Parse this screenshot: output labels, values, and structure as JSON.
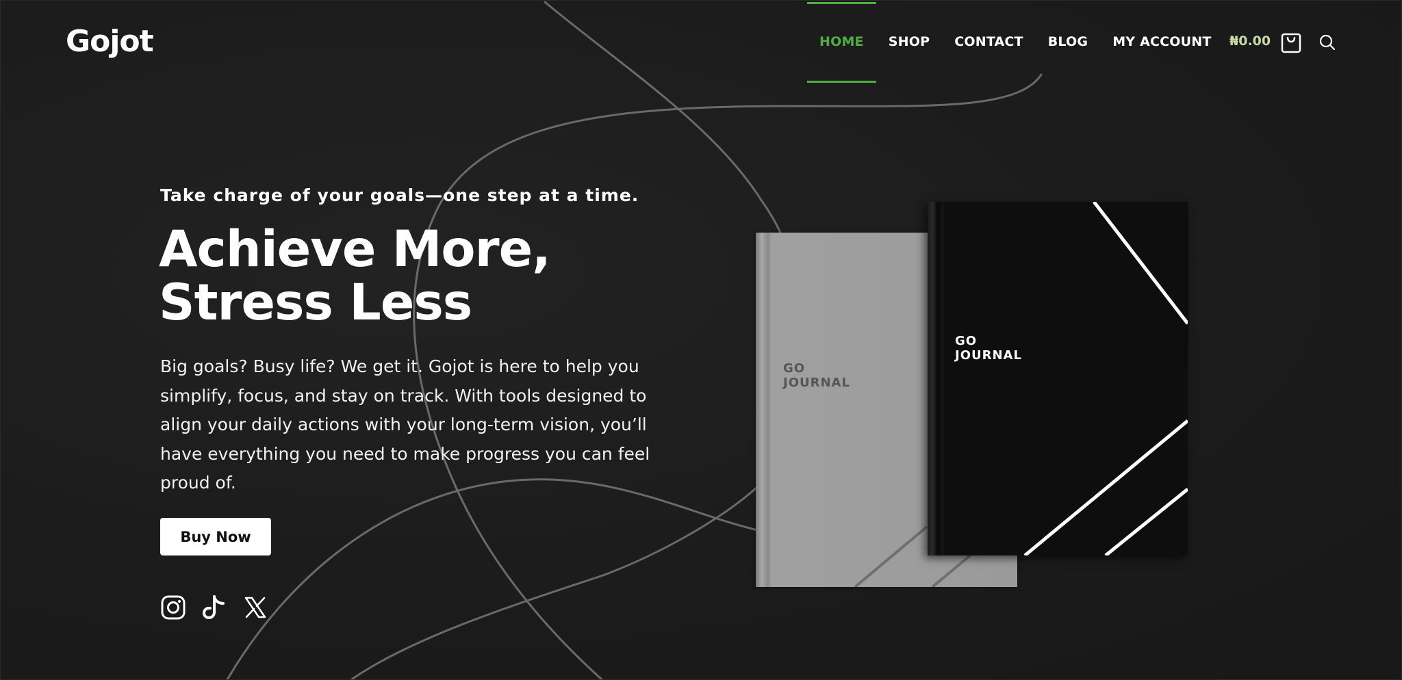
{
  "header": {
    "logo": "Gojot",
    "nav": [
      {
        "label": "HOME",
        "active": true
      },
      {
        "label": "SHOP",
        "active": false
      },
      {
        "label": "CONTACT",
        "active": false
      },
      {
        "label": "BLOG",
        "active": false
      },
      {
        "label": "MY ACCOUNT",
        "active": false
      }
    ],
    "cart_total": "₦0.00",
    "cart_icon": "shopping-bag-icon",
    "search_icon": "search-icon"
  },
  "hero": {
    "tagline": "Take charge of your goals—one step at a time.",
    "headline_line1": "Achieve More,",
    "headline_line2": "Stress Less",
    "description": "Big goals? Busy life? We get it. Gojot is here to help you simplify, focus, and stay on track. With tools designed to align your daily actions with your long-term vision, you’ll have everything you need to make progress you can feel proud of.",
    "button_label": "Buy Now"
  },
  "social": [
    {
      "name": "instagram-icon"
    },
    {
      "name": "tiktok-icon"
    },
    {
      "name": "x-icon"
    }
  ],
  "products": {
    "grey_journal_title_line1": "GO",
    "grey_journal_title_line2": "JOURNAL",
    "black_journal_title_line1": "GO",
    "black_journal_title_line2": "JOURNAL"
  },
  "colors": {
    "background": "#1c1c1c",
    "accent": "#4caf3f",
    "cart_total": "#c8d9a8",
    "text": "#ffffff"
  }
}
